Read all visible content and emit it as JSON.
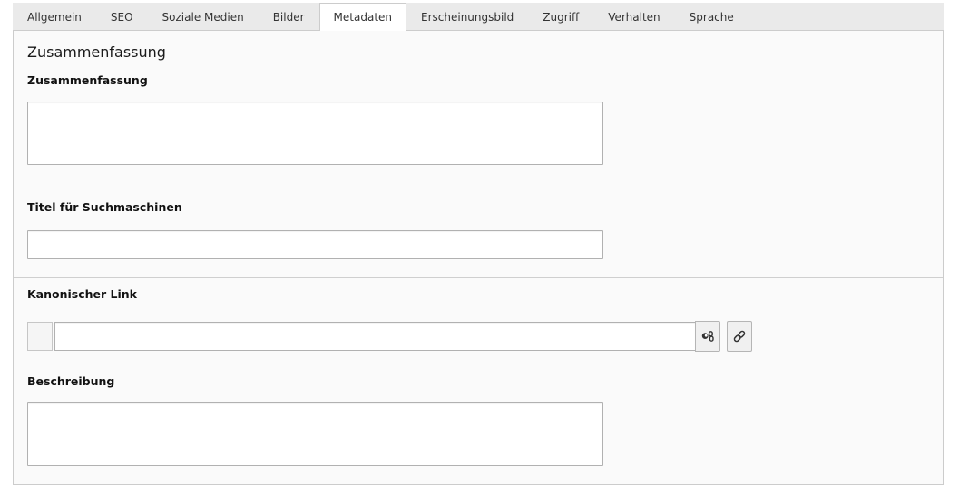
{
  "tabs": [
    {
      "label": "Allgemein",
      "active": false
    },
    {
      "label": "SEO",
      "active": false
    },
    {
      "label": "Soziale Medien",
      "active": false
    },
    {
      "label": "Bilder",
      "active": false
    },
    {
      "label": "Metadaten",
      "active": true
    },
    {
      "label": "Erscheinungsbild",
      "active": false
    },
    {
      "label": "Zugriff",
      "active": false
    },
    {
      "label": "Verhalten",
      "active": false
    },
    {
      "label": "Sprache",
      "active": false
    }
  ],
  "content": {
    "section_title": "Zusammenfassung",
    "summary": {
      "label": "Zusammenfassung",
      "value": ""
    },
    "seo_title": {
      "label": "Titel für Suchmaschinen",
      "value": ""
    },
    "canonical": {
      "label": "Kanonischer Link",
      "value": "",
      "buttons": [
        {
          "icon": "preview-link-icon"
        },
        {
          "icon": "link-browser-icon"
        }
      ]
    },
    "description": {
      "label": "Beschreibung",
      "value": ""
    }
  },
  "colors": {
    "tab_bg": "#eaeaea",
    "active_tab_bg": "#ffffff",
    "panel_bg": "#fafafa",
    "panel_border": "#cccccc",
    "control_border": "#b1b1b1"
  }
}
